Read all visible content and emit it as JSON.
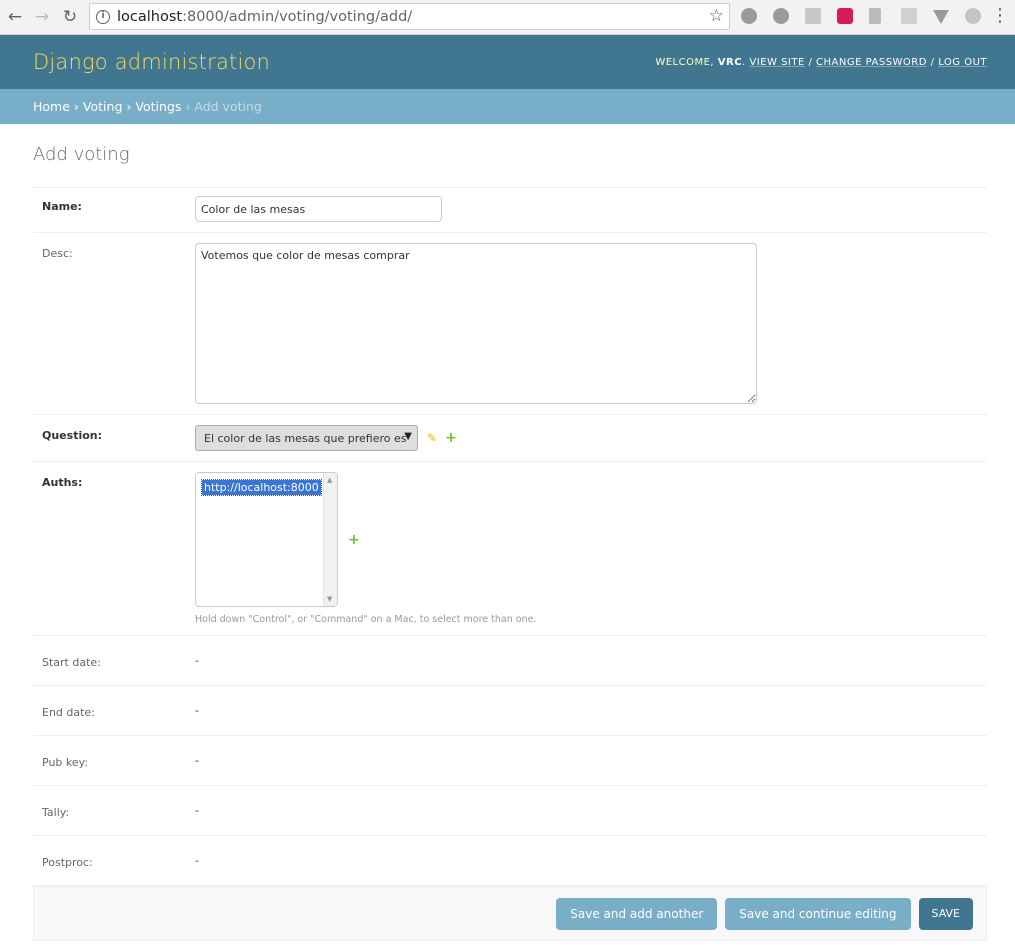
{
  "browser": {
    "url_host": "localhost",
    "url_rest": ":8000/admin/voting/voting/add/"
  },
  "header": {
    "brand": "Django administration",
    "welcome": "WELCOME,",
    "user": "VRC",
    "view_site": "VIEW SITE",
    "change_password": "CHANGE PASSWORD",
    "log_out": "LOG OUT"
  },
  "breadcrumbs": {
    "home": "Home",
    "voting": "Voting",
    "votings": "Votings",
    "current": "Add voting"
  },
  "page": {
    "title": "Add voting"
  },
  "form": {
    "name_label": "Name:",
    "name_value": "Color de las mesas",
    "desc_label": "Desc:",
    "desc_value": "Votemos que color de mesas comprar",
    "question_label": "Question:",
    "question_value": "El color de las mesas que prefiero es",
    "auths_label": "Auths:",
    "auths_option": "http://localhost:8000",
    "auths_help": "Hold down \"Control\", or \"Command\" on a Mac, to select more than one.",
    "start_date_label": "Start date:",
    "start_date_value": "-",
    "end_date_label": "End date:",
    "end_date_value": "-",
    "pub_key_label": "Pub key:",
    "pub_key_value": "-",
    "tally_label": "Tally:",
    "tally_value": "-",
    "postproc_label": "Postproc:",
    "postproc_value": "-"
  },
  "submit": {
    "save_add_another": "Save and add another",
    "save_continue": "Save and continue editing",
    "save": "SAVE"
  },
  "colors": {
    "header_bg": "#417690",
    "brand": "#f5dd5d",
    "breadcrumbs_bg": "#79aec8",
    "add_icon": "#70bf2b",
    "edit_icon": "#efb80b"
  }
}
